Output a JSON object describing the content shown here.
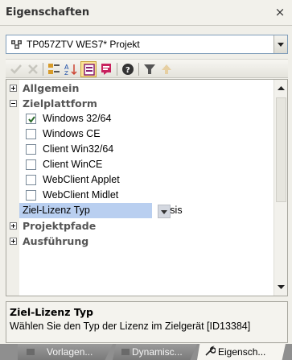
{
  "window": {
    "title": "Eigenschaften",
    "close_glyph": "×"
  },
  "object_selector": {
    "value": "TP057ZTV WES7* Projekt",
    "icon": "project-icon"
  },
  "toolbar": {
    "buttons": [
      {
        "name": "apply-icon",
        "enabled": false
      },
      {
        "name": "delete-icon",
        "enabled": false
      },
      {
        "name": "categorized-icon",
        "enabled": true
      },
      {
        "name": "alphabetical-icon",
        "enabled": true
      },
      {
        "name": "property-pages-icon",
        "enabled": true,
        "active": true
      },
      {
        "name": "event-pages-icon",
        "enabled": true
      },
      {
        "name": "help-icon",
        "enabled": true
      },
      {
        "name": "filter-icon",
        "enabled": true
      },
      {
        "name": "up-icon",
        "enabled": false
      }
    ]
  },
  "grid": {
    "categories": {
      "allgemein": "Allgemein",
      "zielplattform": "Zielplattform",
      "projektpfade": "Projektpfade",
      "ausfuehrung": "Ausführung"
    },
    "platform_options": [
      {
        "label": "Windows 32/64",
        "checked": true
      },
      {
        "label": "Windows CE",
        "checked": false
      },
      {
        "label": "Client Win32/64",
        "checked": false
      },
      {
        "label": "Client WinCE",
        "checked": false
      },
      {
        "label": "WebClient Applet",
        "checked": false
      },
      {
        "label": "WebClient Midlet",
        "checked": false
      }
    ],
    "license_row": {
      "name": "Ziel-Lizenz Typ",
      "value": "Basis"
    }
  },
  "description": {
    "title": "Ziel-Lizenz Typ",
    "text": "Wählen Sie den Typ der Lizenz im Zielgerät [ID13384]"
  },
  "tabs": [
    {
      "label": "Vorlagen...",
      "active": false,
      "icon": "templates-icon"
    },
    {
      "label": "Dynamisc...",
      "active": false,
      "icon": "dynamic-icon"
    },
    {
      "label": "Eigensch...",
      "active": true,
      "icon": "properties-wrench-icon"
    }
  ],
  "colors": {
    "selection": "#b9cff0",
    "active_tab": "#f6f5f0",
    "inactive_tab": "#8a8a8a",
    "active_toolbar_button": "#fbe398"
  }
}
